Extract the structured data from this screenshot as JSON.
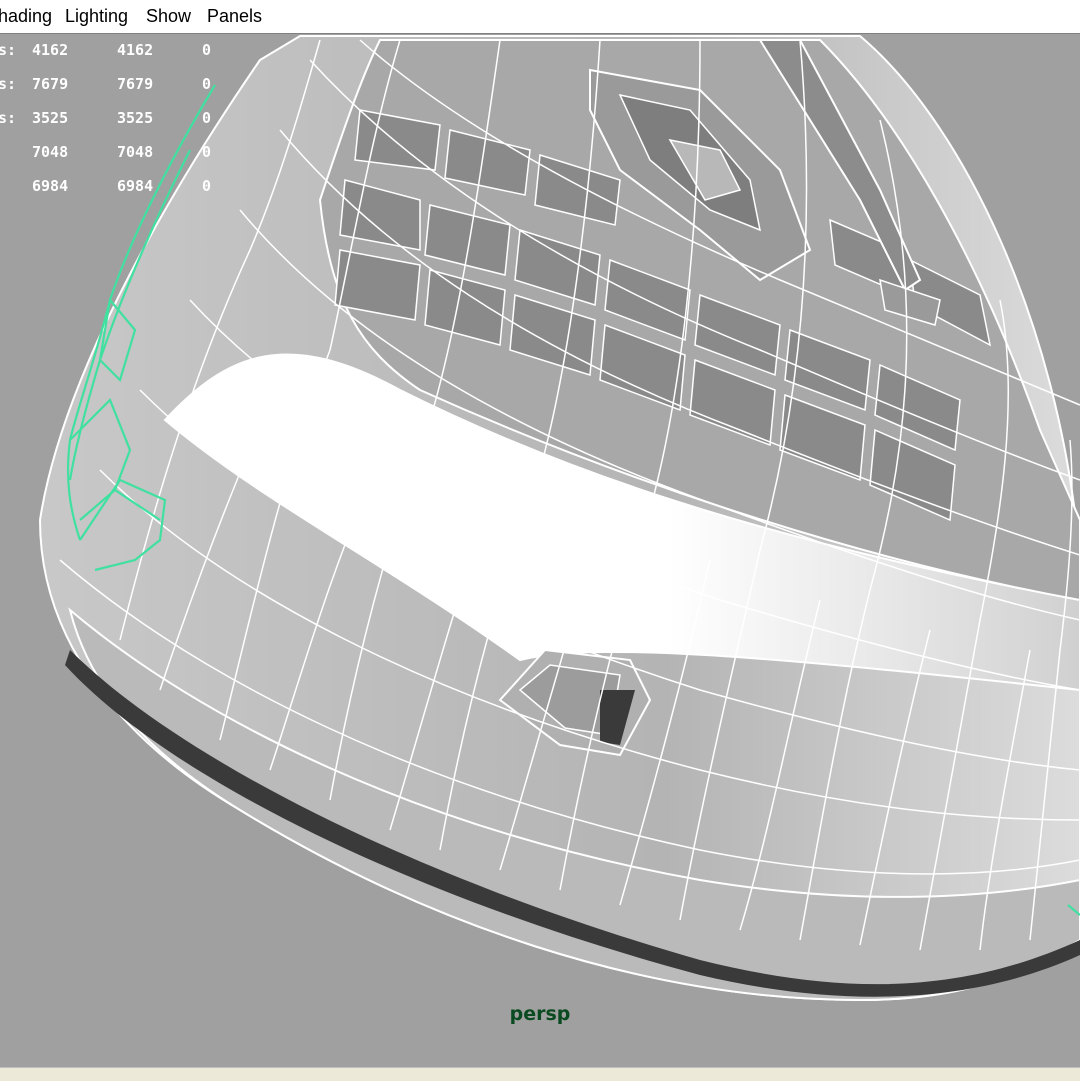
{
  "menu": {
    "items": [
      {
        "id": "shading",
        "label": "hading"
      },
      {
        "id": "lighting",
        "label": "Lighting"
      },
      {
        "id": "show",
        "label": "Show"
      },
      {
        "id": "panels",
        "label": "Panels"
      }
    ]
  },
  "hud": {
    "rows": [
      {
        "label": "s:",
        "a": "4162",
        "b": "4162",
        "c": "0"
      },
      {
        "label": "s:",
        "a": "7679",
        "b": "7679",
        "c": "0"
      },
      {
        "label": "s:",
        "a": "3525",
        "b": "3525",
        "c": "0"
      },
      {
        "label": "",
        "a": "7048",
        "b": "7048",
        "c": "0"
      },
      {
        "label": "",
        "a": "6984",
        "b": "6984",
        "c": "0"
      }
    ]
  },
  "viewport": {
    "camera": "persp",
    "background_color": "#a0a0a0",
    "wire_color": "#ffffff",
    "selection_color": "#40e0a0"
  }
}
